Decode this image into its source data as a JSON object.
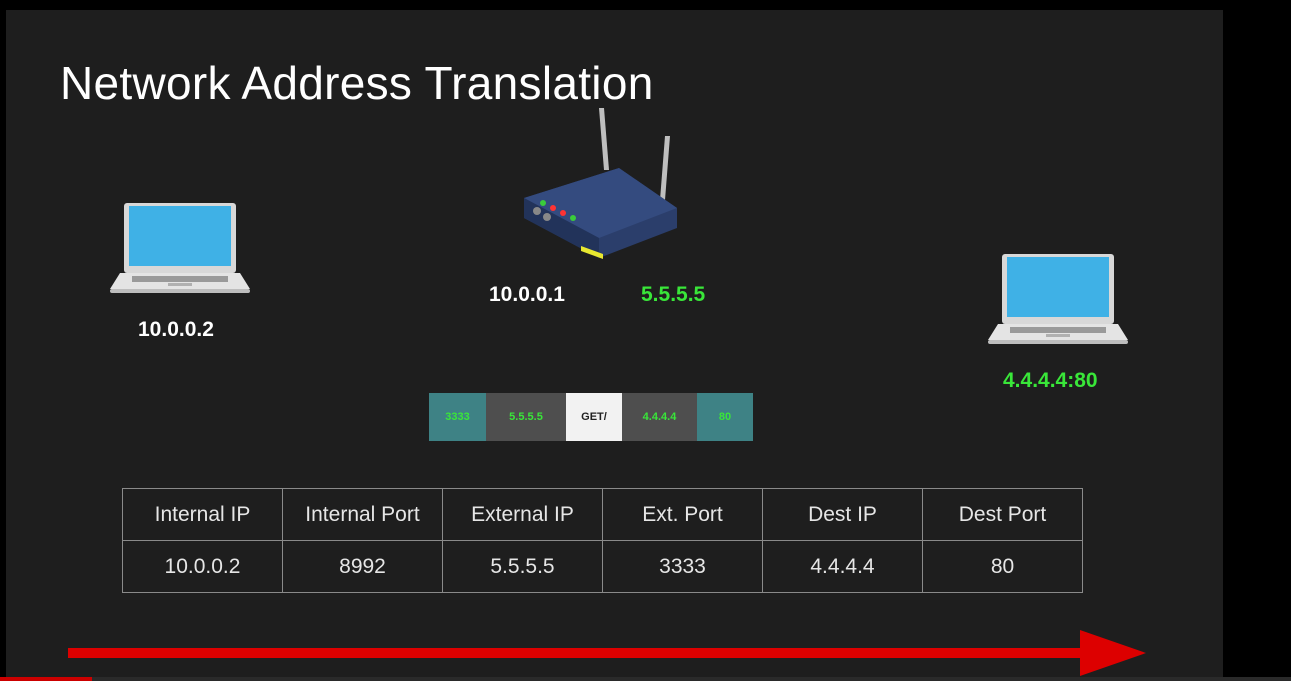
{
  "slide": {
    "title": "Network Address Translation"
  },
  "devices": {
    "client_ip": "10.0.0.2",
    "router_internal_ip": "10.0.0.1",
    "router_external_ip": "5.5.5.5",
    "server_address": "4.4.4.4:80"
  },
  "packet": {
    "segments": [
      "3333",
      "5.5.5.5",
      "GET/",
      "4.4.4.4",
      "80"
    ]
  },
  "nat_table": {
    "headers": [
      "Internal IP",
      "Internal Port",
      "External IP",
      "Ext. Port",
      "Dest IP",
      "Dest Port"
    ],
    "rows": [
      [
        "10.0.0.2",
        "8992",
        "5.5.5.5",
        "3333",
        "4.4.4.4",
        "80"
      ]
    ]
  },
  "colors": {
    "background": "#1e1e1e",
    "highlight_green": "#39e639",
    "arrow_red": "#dd0000",
    "port_segment": "#3e8285",
    "ip_segment": "#4e4e4e",
    "payload_segment": "#f2f2f2",
    "laptop_screen": "#3fb1e6"
  },
  "icons": [
    "laptop-icon",
    "router-icon",
    "laptop-icon",
    "arrow-right-icon"
  ]
}
